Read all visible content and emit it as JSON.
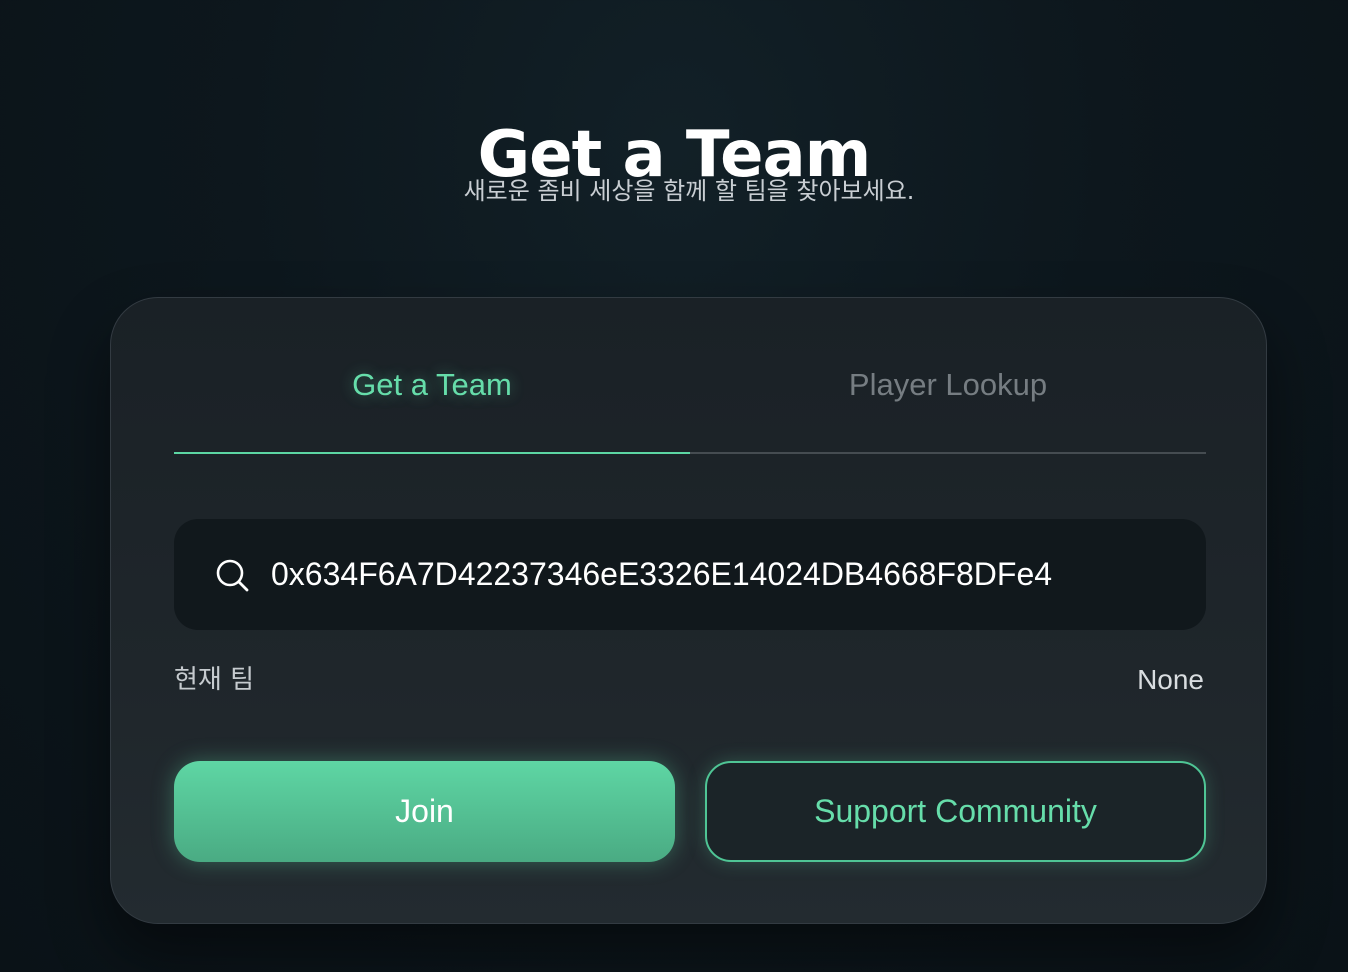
{
  "header": {
    "title": "Get a Team",
    "subtitle": "새로운 좀비 세상을 함께 할 팀을 찾아보세요."
  },
  "tabs": [
    {
      "label": "Get a Team",
      "active": true
    },
    {
      "label": "Player Lookup",
      "active": false
    }
  ],
  "search": {
    "icon": "search-icon",
    "value": "0x634F6A7D42237346eE3326E14024DB4668F8DFe4"
  },
  "current_team": {
    "label": "현재 팀",
    "value": "None"
  },
  "buttons": {
    "join_label": "Join",
    "support_label": "Support Community"
  },
  "colors": {
    "accent": "#5cd6a3",
    "background": "#0d171d",
    "card": "#1f262b"
  }
}
